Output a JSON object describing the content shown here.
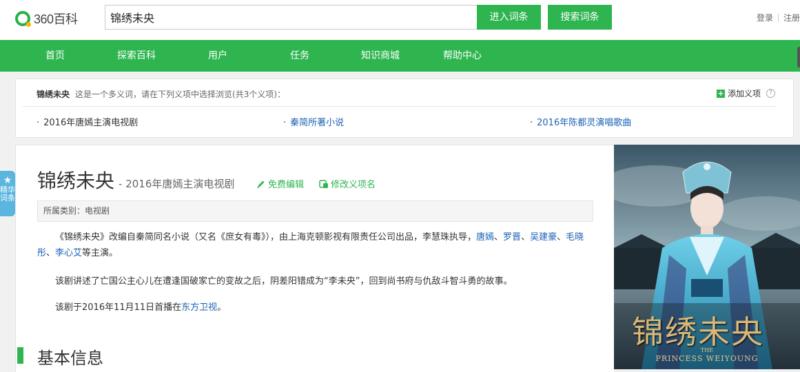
{
  "header": {
    "logo_text": "360百科",
    "search_value": "锦绣未央",
    "enter_button": "进入词条",
    "search_button": "搜索词条",
    "login": "登录",
    "register": "注册"
  },
  "nav": {
    "items": [
      "首页",
      "探索百科",
      "用户",
      "任务",
      "知识商城",
      "帮助中心"
    ]
  },
  "disambiguation": {
    "term": "锦绣未央",
    "description": "这是一个多义词，请在下列义项中选择浏览(共3个义项)：",
    "add_sense": "添加义项",
    "help": "?",
    "senses": [
      {
        "label": "2016年唐嫣主演电视剧"
      },
      {
        "label": "秦简所著小说"
      },
      {
        "label": "2016年陈都灵演唱歌曲"
      }
    ]
  },
  "badge": {
    "text1": "精华",
    "text2": "词条"
  },
  "entry": {
    "title": "锦绣未央",
    "subtitle": "- 2016年唐嫣主演电视剧",
    "free_edit": "免费编辑",
    "modify_sense": "修改义项名",
    "category": "所属类别：电视剧",
    "para1_pre": "《锦绣未央》改编自秦简同名小说（又名《庶女有毒》），由上海克顿影视有限责任公司出品，李慧珠执导，",
    "actors": [
      "唐嫣",
      "罗晋",
      "吴建豪",
      "毛晓彤",
      "李心艾"
    ],
    "para1_post": "等主演。",
    "para2": "该剧讲述了亡国公主心儿在遭逢国破家亡的变故之后，阴差阳错成为“李未央”，回到尚书府与仇敌斗智斗勇的故事。",
    "para3_pre": "该剧于2016年11月11日首播在",
    "para3_link": "东方卫视",
    "para3_post": "。",
    "section_title": "基本信息"
  },
  "poster": {
    "calligraphy": "锦绣未央",
    "english_line1": "THE",
    "english_line2": "PRINCESS WEIYOUNG"
  },
  "colors": {
    "brand_green": "#2fb550",
    "link_blue": "#1a62b6",
    "badge_blue": "#5ab5df"
  }
}
